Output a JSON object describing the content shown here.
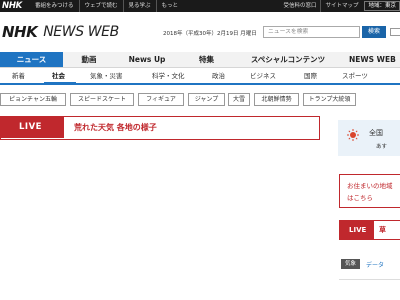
{
  "topbar": {
    "logo": "NHK",
    "links": [
      "番組をみつける",
      "ウェブで読む",
      "見る学ぶ",
      "もっと"
    ],
    "right_links": [
      "受信料の窓口",
      "サイトマップ"
    ],
    "region": "地域：東京"
  },
  "header": {
    "brand_nhk": "NHK",
    "brand_news": "NEWS WEB",
    "date": "2018年（平成30年）2月19日 月曜日",
    "search_placeholder": "ニュースを検索",
    "search_button": "検索"
  },
  "main_nav": [
    {
      "label": "ニュース",
      "active": true
    },
    {
      "label": "動画",
      "active": false
    },
    {
      "label": "News Up",
      "active": false
    },
    {
      "label": "特集",
      "active": false
    },
    {
      "label": "スペシャルコンテンツ",
      "active": false
    },
    {
      "label": "NEWS WEB",
      "active": false
    }
  ],
  "sub_nav": [
    {
      "label": "新着",
      "active": false
    },
    {
      "label": "社会",
      "active": true
    },
    {
      "label": "気象・災害",
      "active": false
    },
    {
      "label": "科学・文化",
      "active": false
    },
    {
      "label": "政治",
      "active": false
    },
    {
      "label": "ビジネス",
      "active": false
    },
    {
      "label": "国際",
      "active": false
    },
    {
      "label": "スポーツ",
      "active": false
    }
  ],
  "tags": [
    "ピョンチャン五輪",
    "スピードスケート",
    "フィギュア",
    "ジャンプ",
    "大雪",
    "北朝鮮情勢",
    "トランプ大統領"
  ],
  "live_banner": {
    "badge": "LIVE",
    "text": "荒れた天気 各地の様子"
  },
  "sidebar": {
    "weather_line1": "全国",
    "weather_line2": "あす",
    "notice_line1": "お住まいの地域",
    "notice_line2": "はこちら",
    "live_badge": "LIVE",
    "live_text": "草",
    "kisho_badge": "気象",
    "kisho_text": "データ"
  },
  "colors": {
    "accent_blue": "#1f74c2",
    "live_red": "#c0282d",
    "topbar_black": "#1a1a1a"
  }
}
